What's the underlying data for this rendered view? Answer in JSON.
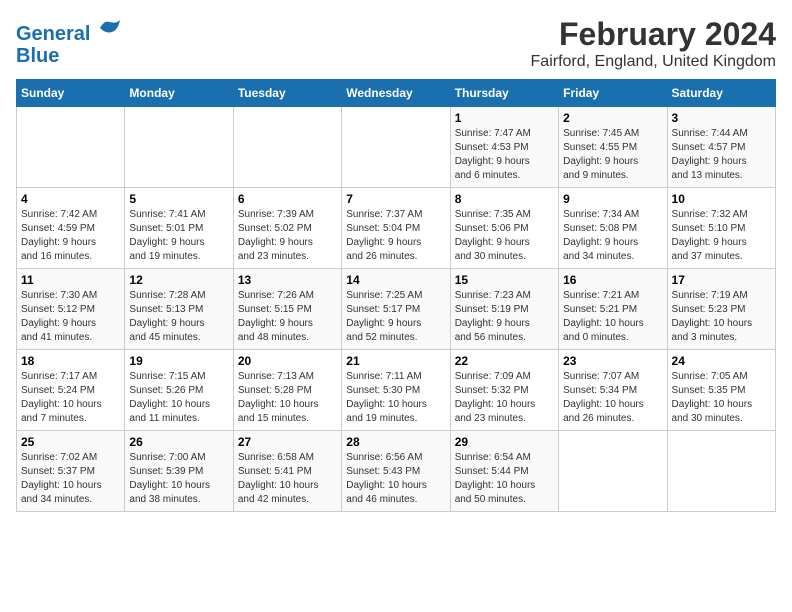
{
  "logo": {
    "line1": "General",
    "line2": "Blue"
  },
  "title": "February 2024",
  "subtitle": "Fairford, England, United Kingdom",
  "days_of_week": [
    "Sunday",
    "Monday",
    "Tuesday",
    "Wednesday",
    "Thursday",
    "Friday",
    "Saturday"
  ],
  "weeks": [
    [
      {
        "day": "",
        "info": ""
      },
      {
        "day": "",
        "info": ""
      },
      {
        "day": "",
        "info": ""
      },
      {
        "day": "",
        "info": ""
      },
      {
        "day": "1",
        "info": "Sunrise: 7:47 AM\nSunset: 4:53 PM\nDaylight: 9 hours\nand 6 minutes."
      },
      {
        "day": "2",
        "info": "Sunrise: 7:45 AM\nSunset: 4:55 PM\nDaylight: 9 hours\nand 9 minutes."
      },
      {
        "day": "3",
        "info": "Sunrise: 7:44 AM\nSunset: 4:57 PM\nDaylight: 9 hours\nand 13 minutes."
      }
    ],
    [
      {
        "day": "4",
        "info": "Sunrise: 7:42 AM\nSunset: 4:59 PM\nDaylight: 9 hours\nand 16 minutes."
      },
      {
        "day": "5",
        "info": "Sunrise: 7:41 AM\nSunset: 5:01 PM\nDaylight: 9 hours\nand 19 minutes."
      },
      {
        "day": "6",
        "info": "Sunrise: 7:39 AM\nSunset: 5:02 PM\nDaylight: 9 hours\nand 23 minutes."
      },
      {
        "day": "7",
        "info": "Sunrise: 7:37 AM\nSunset: 5:04 PM\nDaylight: 9 hours\nand 26 minutes."
      },
      {
        "day": "8",
        "info": "Sunrise: 7:35 AM\nSunset: 5:06 PM\nDaylight: 9 hours\nand 30 minutes."
      },
      {
        "day": "9",
        "info": "Sunrise: 7:34 AM\nSunset: 5:08 PM\nDaylight: 9 hours\nand 34 minutes."
      },
      {
        "day": "10",
        "info": "Sunrise: 7:32 AM\nSunset: 5:10 PM\nDaylight: 9 hours\nand 37 minutes."
      }
    ],
    [
      {
        "day": "11",
        "info": "Sunrise: 7:30 AM\nSunset: 5:12 PM\nDaylight: 9 hours\nand 41 minutes."
      },
      {
        "day": "12",
        "info": "Sunrise: 7:28 AM\nSunset: 5:13 PM\nDaylight: 9 hours\nand 45 minutes."
      },
      {
        "day": "13",
        "info": "Sunrise: 7:26 AM\nSunset: 5:15 PM\nDaylight: 9 hours\nand 48 minutes."
      },
      {
        "day": "14",
        "info": "Sunrise: 7:25 AM\nSunset: 5:17 PM\nDaylight: 9 hours\nand 52 minutes."
      },
      {
        "day": "15",
        "info": "Sunrise: 7:23 AM\nSunset: 5:19 PM\nDaylight: 9 hours\nand 56 minutes."
      },
      {
        "day": "16",
        "info": "Sunrise: 7:21 AM\nSunset: 5:21 PM\nDaylight: 10 hours\nand 0 minutes."
      },
      {
        "day": "17",
        "info": "Sunrise: 7:19 AM\nSunset: 5:23 PM\nDaylight: 10 hours\nand 3 minutes."
      }
    ],
    [
      {
        "day": "18",
        "info": "Sunrise: 7:17 AM\nSunset: 5:24 PM\nDaylight: 10 hours\nand 7 minutes."
      },
      {
        "day": "19",
        "info": "Sunrise: 7:15 AM\nSunset: 5:26 PM\nDaylight: 10 hours\nand 11 minutes."
      },
      {
        "day": "20",
        "info": "Sunrise: 7:13 AM\nSunset: 5:28 PM\nDaylight: 10 hours\nand 15 minutes."
      },
      {
        "day": "21",
        "info": "Sunrise: 7:11 AM\nSunset: 5:30 PM\nDaylight: 10 hours\nand 19 minutes."
      },
      {
        "day": "22",
        "info": "Sunrise: 7:09 AM\nSunset: 5:32 PM\nDaylight: 10 hours\nand 23 minutes."
      },
      {
        "day": "23",
        "info": "Sunrise: 7:07 AM\nSunset: 5:34 PM\nDaylight: 10 hours\nand 26 minutes."
      },
      {
        "day": "24",
        "info": "Sunrise: 7:05 AM\nSunset: 5:35 PM\nDaylight: 10 hours\nand 30 minutes."
      }
    ],
    [
      {
        "day": "25",
        "info": "Sunrise: 7:02 AM\nSunset: 5:37 PM\nDaylight: 10 hours\nand 34 minutes."
      },
      {
        "day": "26",
        "info": "Sunrise: 7:00 AM\nSunset: 5:39 PM\nDaylight: 10 hours\nand 38 minutes."
      },
      {
        "day": "27",
        "info": "Sunrise: 6:58 AM\nSunset: 5:41 PM\nDaylight: 10 hours\nand 42 minutes."
      },
      {
        "day": "28",
        "info": "Sunrise: 6:56 AM\nSunset: 5:43 PM\nDaylight: 10 hours\nand 46 minutes."
      },
      {
        "day": "29",
        "info": "Sunrise: 6:54 AM\nSunset: 5:44 PM\nDaylight: 10 hours\nand 50 minutes."
      },
      {
        "day": "",
        "info": ""
      },
      {
        "day": "",
        "info": ""
      }
    ]
  ]
}
